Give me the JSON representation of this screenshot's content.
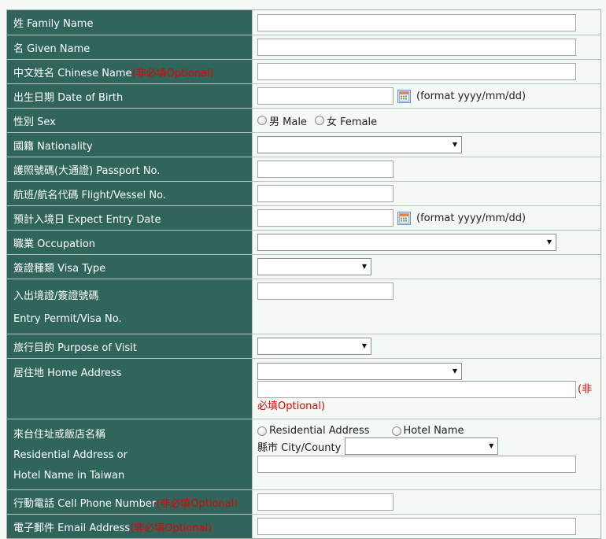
{
  "colors": {
    "label_bg": "#2f655b",
    "label_text": "#ffffff",
    "row_bg": "#f4f9f5",
    "page_bg": "#f5f9f6",
    "grid_border": "#bac3bc",
    "required_red": "#e60000"
  },
  "icons": {
    "dropdown_arrow": "▼"
  },
  "form": {
    "family_name": {
      "label": "姓 Family Name"
    },
    "given_name": {
      "label": "名 Given Name"
    },
    "chinese_name": {
      "label": "中文姓名 Chinese Name",
      "note": "(非必填Optional)"
    },
    "birth_date": {
      "label": "出生日期 Date of Birth",
      "hint": "(format yyyy/mm/dd)"
    },
    "sex": {
      "label": "性別 Sex",
      "male": "男 Male",
      "female": "女 Female"
    },
    "nationality": {
      "label": "國籍 Nationality",
      "selected": ""
    },
    "passport": {
      "label": "護照號碼(大通證) Passport No."
    },
    "flight": {
      "label": "航班/航名代碼 Flight/Vessel No."
    },
    "entry_date": {
      "label": "預計入境日 Expect Entry Date",
      "hint": "(format yyyy/mm/dd)"
    },
    "occupation": {
      "label": "職業 Occupation",
      "selected": ""
    },
    "visa_type": {
      "label": "簽證種類 Visa Type",
      "selected": ""
    },
    "entry_permit": {
      "label_line1": "入出境證/簽證號碼",
      "label_line2": "Entry Permit/Visa No."
    },
    "purpose": {
      "label": "旅行目的 Purpose of Visit",
      "selected": ""
    },
    "home_address": {
      "label": "居住地 Home Address",
      "note": "(非必填Optional)",
      "selected": ""
    },
    "taiwan_address": {
      "label_line1": "來台住址或飯店名稱",
      "label_line2": "Residential Address or",
      "label_line3": "Hotel Name in Taiwan",
      "radio_residential": "Residential Address",
      "radio_hotel": "Hotel Name",
      "city_label": "縣市 City/County",
      "city_selected": ""
    },
    "cell_phone": {
      "label": "行動電話 Cell Phone Number",
      "note": "(非必填Optional)"
    },
    "email": {
      "label": "電子郵件 Email Address",
      "note": "(非必填Optional)"
    }
  }
}
